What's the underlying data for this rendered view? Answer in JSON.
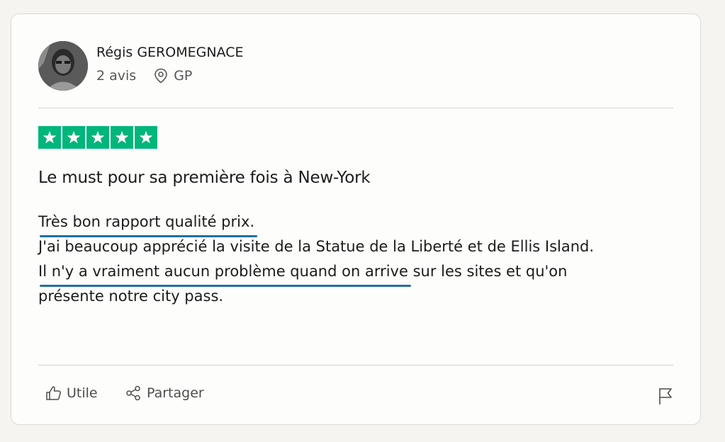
{
  "reviewer": {
    "name": "Régis GEROMEGNACE",
    "reviews_count": "2 avis",
    "location": "GP"
  },
  "rating": {
    "stars": 5,
    "max": 5,
    "color": "#00b67a"
  },
  "review": {
    "title": "Le must pour sa première fois à New-York",
    "lines": [
      {
        "highlight": "Très bon rapport qualité prix.",
        "rest": ""
      },
      {
        "highlight": "",
        "rest": "J'ai beaucoup apprécié la visite de la Statue de la Liberté et de Ellis Island."
      },
      {
        "highlight": "Il n'y a vraiment aucun problème quand on arrive",
        "rest": " sur les sites et qu'on"
      },
      {
        "highlight": "",
        "rest": "présente notre city pass."
      }
    ]
  },
  "actions": {
    "useful_label": "Utile",
    "share_label": "Partager"
  },
  "icons": {
    "location": "location-pin-icon",
    "useful": "thumbs-up-icon",
    "share": "share-icon",
    "report": "flag-icon",
    "star": "star-icon"
  },
  "colors": {
    "underline": "#1f6fa5",
    "star_bg": "#00b67a"
  }
}
